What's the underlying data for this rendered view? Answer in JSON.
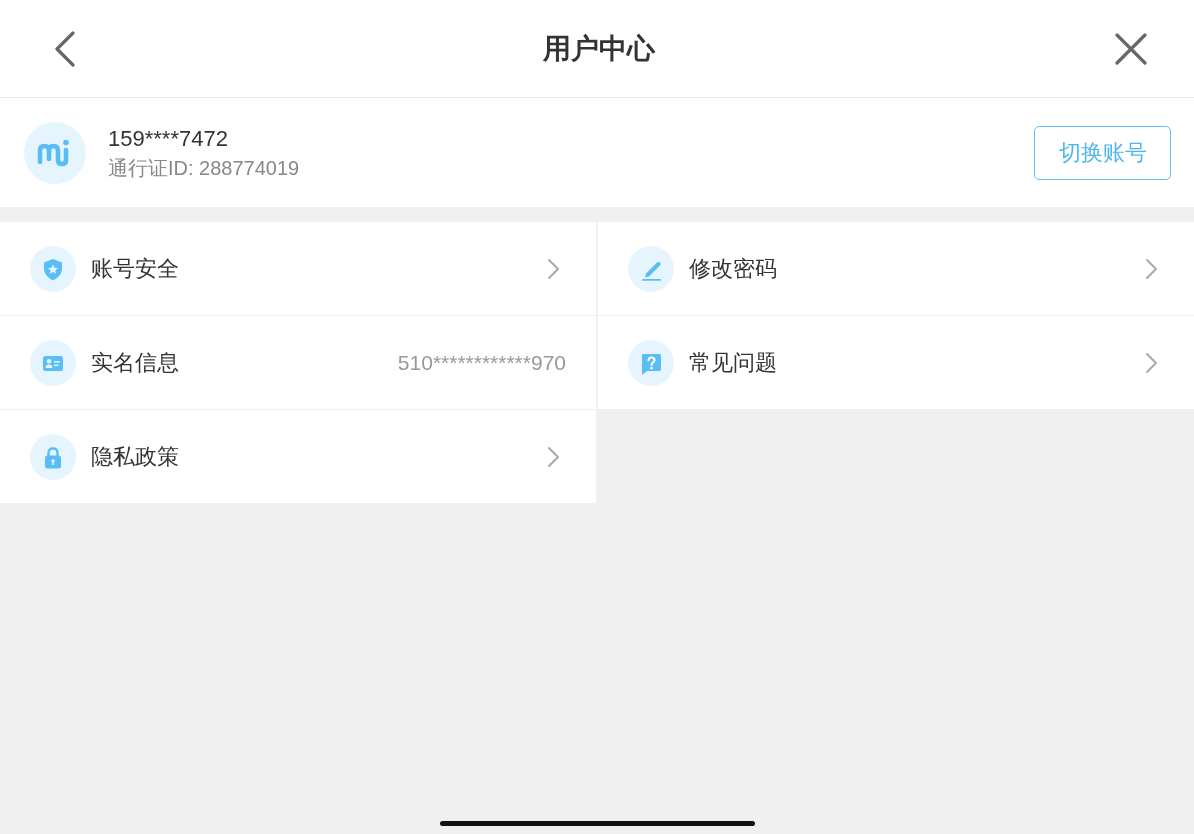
{
  "header": {
    "title": "用户中心"
  },
  "account": {
    "phone": "159****7472",
    "pass_id": "通行证ID: 288774019",
    "switch_button": "切换账号"
  },
  "menu_items": [
    {
      "label": "账号安全",
      "kind": "link"
    },
    {
      "label": "修改密码",
      "kind": "link"
    },
    {
      "label": "实名信息",
      "kind": "value",
      "value": "510************970"
    },
    {
      "label": "常见问题",
      "kind": "link"
    },
    {
      "label": "隐私政策",
      "kind": "link"
    }
  ]
}
